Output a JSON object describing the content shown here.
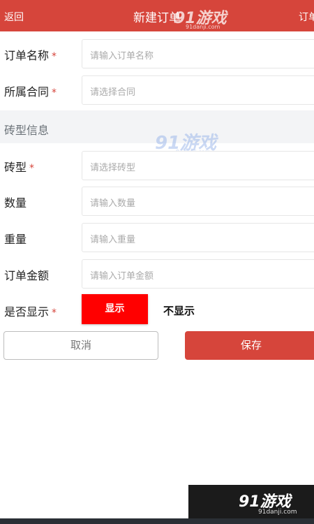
{
  "header": {
    "back_label": "返回",
    "title": "新建订单",
    "right_label": "订单"
  },
  "form": {
    "order_name": {
      "label": "订单名称",
      "required": "*",
      "placeholder": "请输入订单名称"
    },
    "contract": {
      "label": "所属合同",
      "required": "*",
      "placeholder": "请选择合同"
    },
    "section_title": "砖型信息",
    "brick_type": {
      "label": "砖型",
      "required": "*",
      "placeholder": "请选择砖型"
    },
    "quantity": {
      "label": "数量",
      "placeholder": "请输入数量"
    },
    "weight": {
      "label": "重量",
      "placeholder": "请输入重量"
    },
    "amount": {
      "label": "订单金额",
      "placeholder": "请输入订单金额"
    },
    "display": {
      "label": "是否显示",
      "required": "*",
      "option_on": "显示",
      "option_off": "不显示",
      "selected": "显示"
    }
  },
  "actions": {
    "cancel_label": "取消",
    "save_label": "保存"
  },
  "watermark": {
    "logo_text": "91游戏",
    "url_text": "91danji.com"
  },
  "colors": {
    "brand_red": "#d6453b",
    "toggle_red": "#ff0000"
  }
}
